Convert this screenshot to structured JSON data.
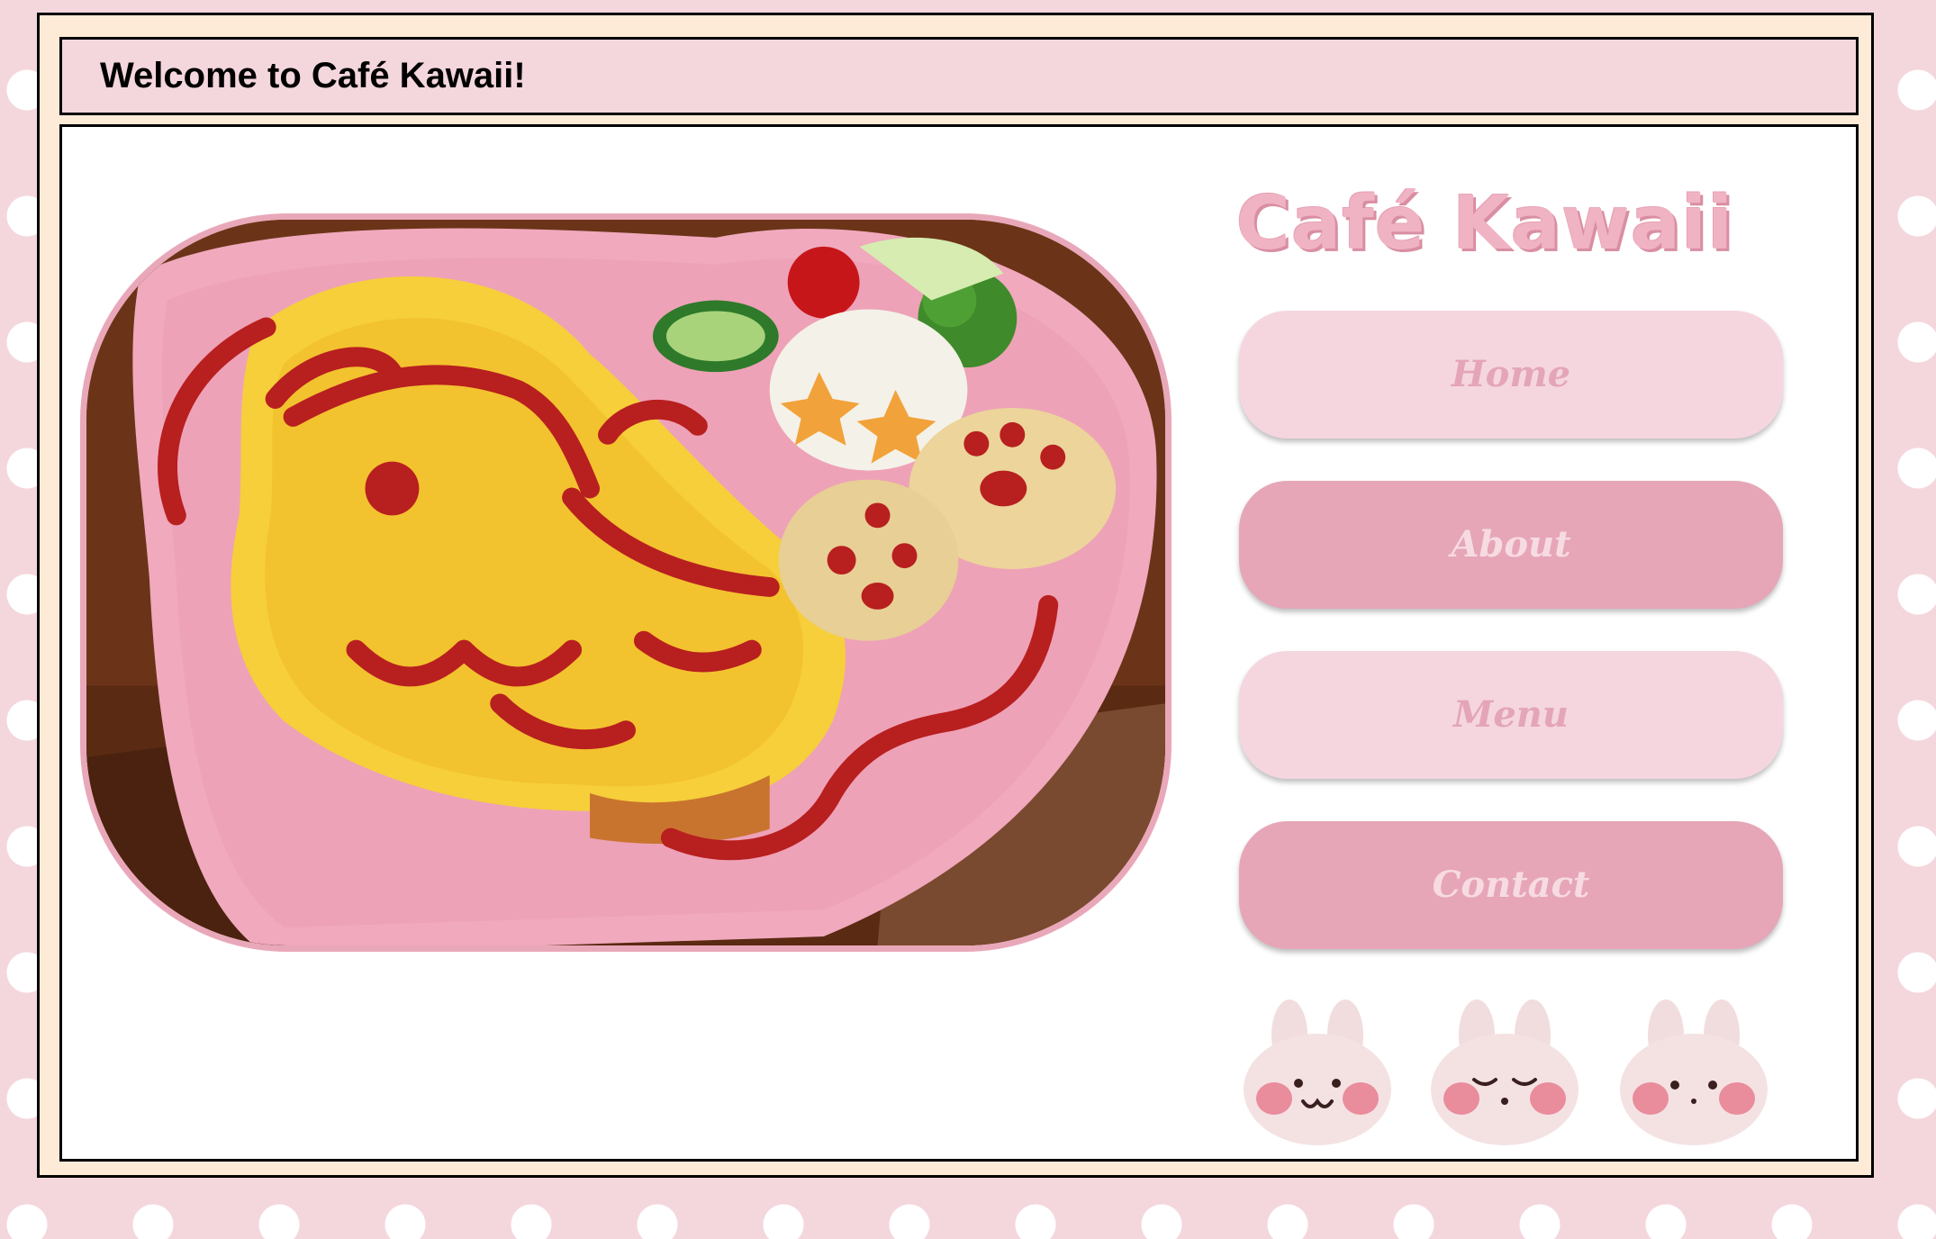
{
  "header": {
    "title": "Welcome to Café Kawaii!"
  },
  "brand": {
    "name": "Café Kawaii"
  },
  "nav": {
    "items": [
      {
        "label": "Home"
      },
      {
        "label": "About"
      },
      {
        "label": "Menu"
      },
      {
        "label": "Contact"
      }
    ]
  },
  "colors": {
    "background": "#f4d6dd",
    "frame": "#fdebd7",
    "accent": "#e6a6b8",
    "accent_light": "#f5d6df",
    "brand_text": "#f0b3c4"
  },
  "images": {
    "hero": "omurice-cat-face-heart-plate",
    "bunnies": [
      "bunny-smiling",
      "bunny-sleepy",
      "bunny-neutral"
    ]
  }
}
